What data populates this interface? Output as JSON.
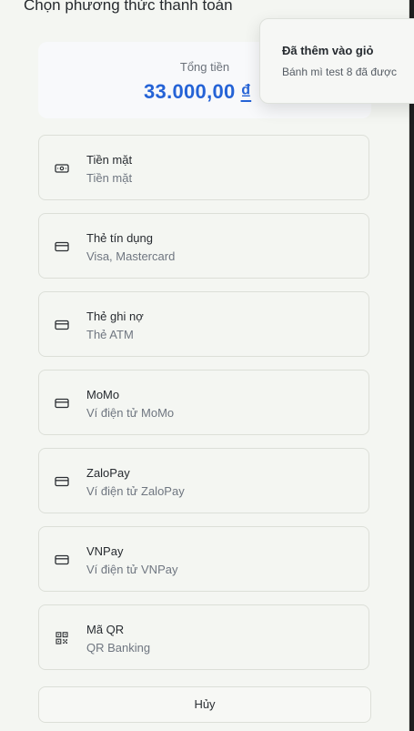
{
  "dialog": {
    "title": "Chọn phương thức thanh toán",
    "total_label": "Tổng tiền",
    "total_amount": "33.000,00",
    "currency": "₫",
    "cancel_label": "Hủy"
  },
  "methods": [
    {
      "name": "Tiền mặt",
      "desc": "Tiền mặt",
      "icon": "cash-icon"
    },
    {
      "name": "Thẻ tín dụng",
      "desc": "Visa, Mastercard",
      "icon": "credit-card-icon"
    },
    {
      "name": "Thẻ ghi nợ",
      "desc": "Thẻ ATM",
      "icon": "credit-card-icon"
    },
    {
      "name": "MoMo",
      "desc": "Ví điện tử MoMo",
      "icon": "credit-card-icon"
    },
    {
      "name": "ZaloPay",
      "desc": "Ví điện tử ZaloPay",
      "icon": "credit-card-icon"
    },
    {
      "name": "VNPay",
      "desc": "Ví điện tử VNPay",
      "icon": "credit-card-icon"
    },
    {
      "name": "Mã QR",
      "desc": "QR Banking",
      "icon": "qr-code-icon"
    }
  ],
  "toast": {
    "title": "Đã thêm vào giỏ",
    "message": "Bánh mì test 8 đã được"
  },
  "colors": {
    "accent": "#2563d6",
    "background": "#f4f6f2"
  }
}
